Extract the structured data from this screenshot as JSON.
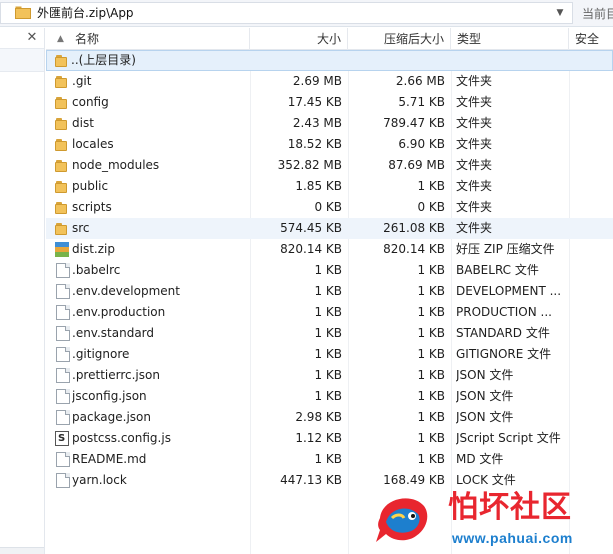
{
  "address": {
    "path": "外匯前台.zip\\App",
    "right_text": "当前目"
  },
  "columns": {
    "name": "名称",
    "size": "大小",
    "packed": "压缩后大小",
    "type": "类型",
    "security": "安全"
  },
  "up_row": {
    "label": "..(上层目录)"
  },
  "rows": [
    {
      "name": ".git",
      "size": "2.69 MB",
      "packed": "2.66 MB",
      "type": "文件夹",
      "icon": "folder-icon"
    },
    {
      "name": "config",
      "size": "17.45 KB",
      "packed": "5.71 KB",
      "type": "文件夹",
      "icon": "folder-icon"
    },
    {
      "name": "dist",
      "size": "2.43 MB",
      "packed": "789.47 KB",
      "type": "文件夹",
      "icon": "folder-icon"
    },
    {
      "name": "locales",
      "size": "18.52 KB",
      "packed": "6.90 KB",
      "type": "文件夹",
      "icon": "folder-icon"
    },
    {
      "name": "node_modules",
      "size": "352.82 MB",
      "packed": "87.69 MB",
      "type": "文件夹",
      "icon": "folder-icon"
    },
    {
      "name": "public",
      "size": "1.85 KB",
      "packed": "1 KB",
      "type": "文件夹",
      "icon": "folder-icon"
    },
    {
      "name": "scripts",
      "size": "0 KB",
      "packed": "0 KB",
      "type": "文件夹",
      "icon": "folder-icon"
    },
    {
      "name": "src",
      "size": "574.45 KB",
      "packed": "261.08 KB",
      "type": "文件夹",
      "icon": "folder-icon"
    },
    {
      "name": "dist.zip",
      "size": "820.14 KB",
      "packed": "820.14 KB",
      "type": "好压 ZIP 压缩文件",
      "icon": "zip-icon"
    },
    {
      "name": ".babelrc",
      "size": "1 KB",
      "packed": "1 KB",
      "type": "BABELRC 文件",
      "icon": "file-icon"
    },
    {
      "name": ".env.development",
      "size": "1 KB",
      "packed": "1 KB",
      "type": "DEVELOPMENT ...",
      "icon": "file-icon"
    },
    {
      "name": ".env.production",
      "size": "1 KB",
      "packed": "1 KB",
      "type": "PRODUCTION ...",
      "icon": "file-icon"
    },
    {
      "name": ".env.standard",
      "size": "1 KB",
      "packed": "1 KB",
      "type": "STANDARD 文件",
      "icon": "file-icon"
    },
    {
      "name": ".gitignore",
      "size": "1 KB",
      "packed": "1 KB",
      "type": "GITIGNORE 文件",
      "icon": "file-icon"
    },
    {
      "name": ".prettierrc.json",
      "size": "1 KB",
      "packed": "1 KB",
      "type": "JSON 文件",
      "icon": "file-icon"
    },
    {
      "name": "jsconfig.json",
      "size": "1 KB",
      "packed": "1 KB",
      "type": "JSON 文件",
      "icon": "file-icon"
    },
    {
      "name": "package.json",
      "size": "2.98 KB",
      "packed": "1 KB",
      "type": "JSON 文件",
      "icon": "file-icon"
    },
    {
      "name": "postcss.config.js",
      "size": "1.12 KB",
      "packed": "1 KB",
      "type": "JScript Script 文件",
      "icon": "js-icon"
    },
    {
      "name": "README.md",
      "size": "1 KB",
      "packed": "1 KB",
      "type": "MD 文件",
      "icon": "file-icon"
    },
    {
      "name": "yarn.lock",
      "size": "447.13 KB",
      "packed": "168.49 KB",
      "type": "LOCK 文件",
      "icon": "file-icon"
    }
  ],
  "watermark": {
    "title": "怕坏社区",
    "url": "www.pahuai.com"
  },
  "colors": {
    "selection": "#e5f0fb",
    "folder": "#f2c25a",
    "watermark_red": "#e8262f",
    "watermark_blue": "#1d7fce"
  }
}
